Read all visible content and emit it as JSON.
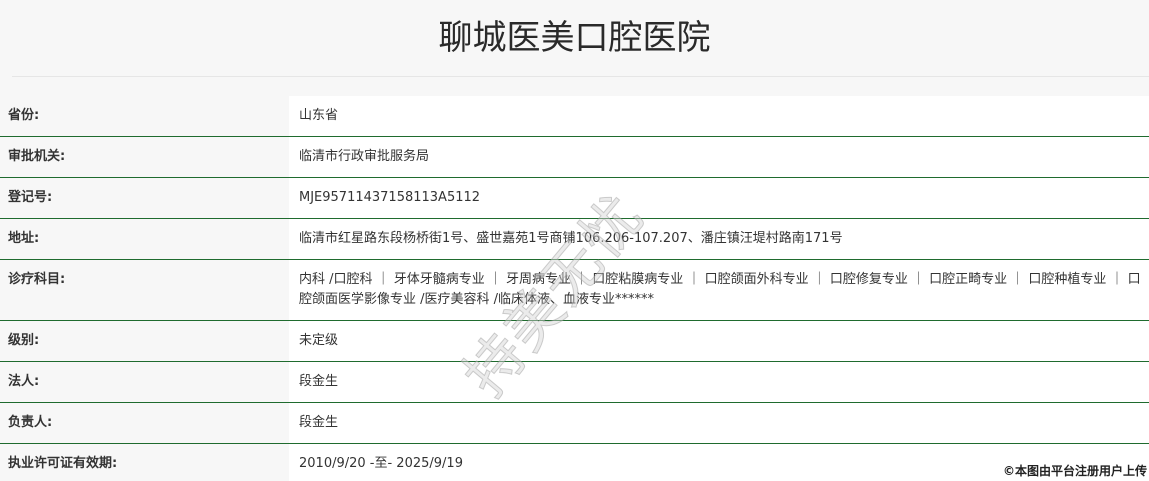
{
  "header": {
    "title": "聊城医美口腔医院"
  },
  "rows": [
    {
      "label": "省份:",
      "value": "山东省"
    },
    {
      "label": "审批机关:",
      "value": "临清市行政审批服务局"
    },
    {
      "label": "登记号:",
      "value": "MJE95711437158113A5112"
    },
    {
      "label": "地址:",
      "value": "临清市红星路东段杨桥街1号、盛世嘉苑1号商铺106.206-107.207、潘庄镇汪堤村路南171号"
    },
    {
      "label": "诊疗科目:",
      "value": "内科 /口腔科 ｜ 牙体牙髓病专业 ｜ 牙周病专业 ｜ 口腔粘膜病专业 ｜ 口腔颌面外科专业 ｜ 口腔修复专业 ｜ 口腔正畸专业 ｜ 口腔种植专业 ｜ 口腔颌面医学影像专业 /医疗美容科 /临床体液、血液专业******"
    },
    {
      "label": "级别:",
      "value": "未定级"
    },
    {
      "label": "法人:",
      "value": "段金生"
    },
    {
      "label": "负责人:",
      "value": "段金生"
    },
    {
      "label": "执业许可证有效期:",
      "value": "2010/9/20 -至- 2025/9/19"
    }
  ],
  "watermark": "持美无忧",
  "copyright": "©本图由平台注册用户上传"
}
